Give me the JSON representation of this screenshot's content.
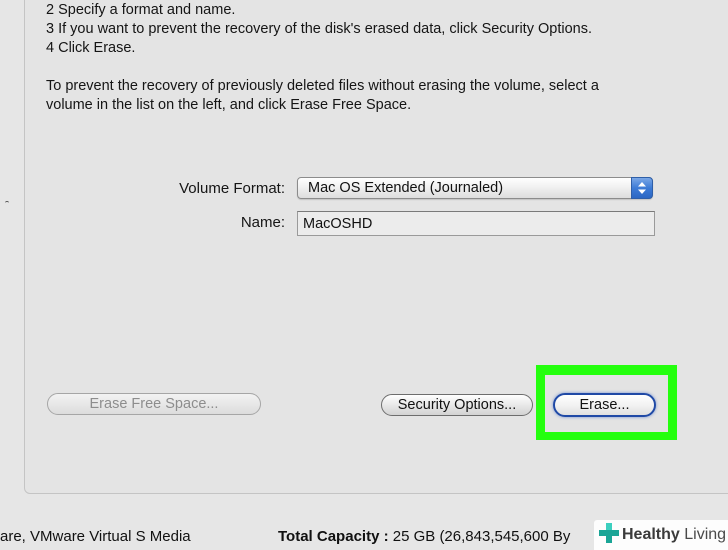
{
  "instructions": {
    "step2": "2  Specify a format and name.",
    "step3": "3  If you want to prevent the recovery of the disk's erased data, click Security Options.",
    "step4": "4  Click Erase.",
    "free_space_line1": "To prevent the recovery of previously deleted files without erasing the volume, select a",
    "free_space_line2": "volume in the list on the left, and click Erase Free Space."
  },
  "form": {
    "volume_format_label": "Volume Format:",
    "volume_format_value": "Mac OS Extended (Journaled)",
    "name_label": "Name:",
    "name_value": "MacOSHD"
  },
  "buttons": {
    "erase_free_space": "Erase Free Space...",
    "security_options": "Security Options...",
    "erase": "Erase..."
  },
  "status_bar": {
    "media_text": "are, VMware Virtual S Media",
    "capacity_label": "Total Capacity :",
    "capacity_value": "25 GB (26,843,545,600 By"
  },
  "watermark": {
    "brand_strong": "Healthy",
    "brand_light": "Living",
    "icon": "medical-cross-icon"
  },
  "colors": {
    "highlight": "#24ff0e",
    "default_button_border": "#1f49a6",
    "popup_arrow": "#3d7bd6"
  }
}
